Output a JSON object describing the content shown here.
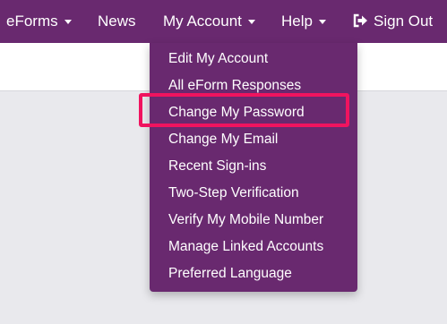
{
  "nav": {
    "eforms_label": "eForms",
    "news_label": "News",
    "my_account_label": "My Account",
    "help_label": "Help",
    "sign_out_label": "Sign Out"
  },
  "account_menu": {
    "items": [
      {
        "label": "Edit My Account"
      },
      {
        "label": "All eForm Responses"
      },
      {
        "label": "Change My Password"
      },
      {
        "label": "Change My Email"
      },
      {
        "label": "Recent Sign-ins"
      },
      {
        "label": "Two-Step Verification"
      },
      {
        "label": "Verify My Mobile Number"
      },
      {
        "label": "Manage Linked Accounts"
      },
      {
        "label": "Preferred Language"
      }
    ],
    "highlighted_item": "Change My Password"
  },
  "colors": {
    "navbar_bg": "#69296f",
    "highlight_border": "#f0135f",
    "page_bg": "#e9e9ed"
  },
  "icons": {
    "sign_out": "sign-out-icon",
    "dropdown": "caret-down-icon"
  }
}
